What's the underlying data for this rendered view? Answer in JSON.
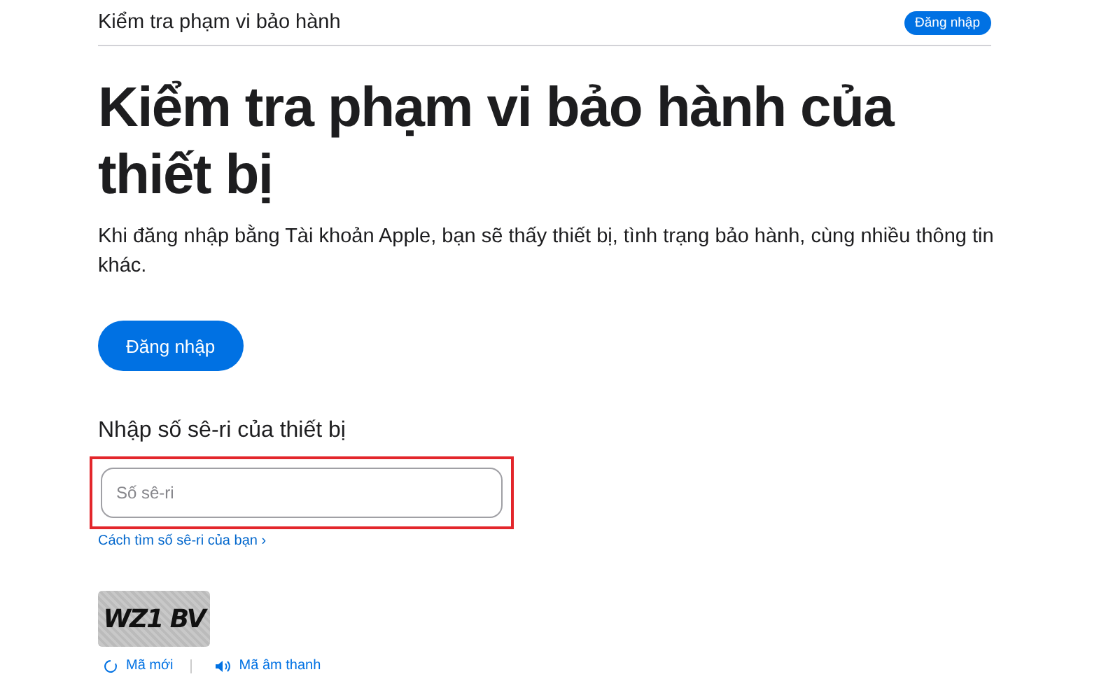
{
  "header": {
    "title": "Kiểm tra phạm vi bảo hành",
    "sign_in": "Đăng nhập"
  },
  "heading": "Kiểm tra phạm vi bảo hành của thiết bị",
  "intro": "Khi đăng nhập bằng Tài khoản Apple, bạn sẽ thấy thiết bị, tình trạng bảo hành, cùng nhiều thông tin khác.",
  "sign_in_button": "Đăng nhập",
  "serial": {
    "label": "Nhập số sê-ri của thiết bị",
    "placeholder": "Số sê-ri",
    "highlighted": true,
    "help_link": "Cách tìm số sê-ri của bạn ›"
  },
  "captcha": {
    "code": "WZ1 BV",
    "new_code": "Mã mới",
    "audio_code": "Mã âm thanh"
  }
}
